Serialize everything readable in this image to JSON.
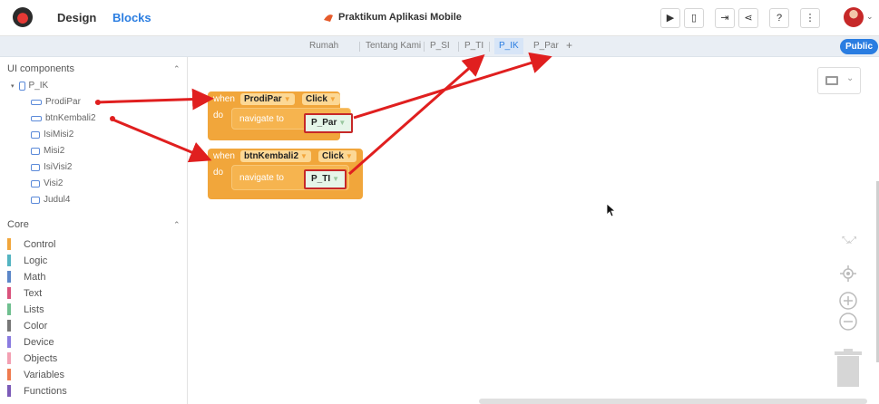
{
  "header": {
    "tabs": [
      "Design",
      "Blocks"
    ],
    "active_tab": "Blocks",
    "project_title": "Praktikum Aplikasi Mobile",
    "toolbar_icons": [
      "preview-icon",
      "phone-preview-icon",
      "export-icon",
      "share-icon",
      "help-icon",
      "more-icon"
    ]
  },
  "screens": {
    "tabs": [
      "Rumah",
      "Tentang Kami",
      "P_SI",
      "P_TI",
      "P_IK",
      "P_Par"
    ],
    "active": "P_IK",
    "add_label": "+",
    "visibility": "Public"
  },
  "sidebar": {
    "ui_heading": "UI components",
    "screen_node": "P_IK",
    "components": [
      {
        "label": "ProdiPar",
        "icon": "button-icon"
      },
      {
        "label": "btnKembali2",
        "icon": "button-icon"
      },
      {
        "label": "IsiMisi2",
        "icon": "label-icon"
      },
      {
        "label": "Misi2",
        "icon": "label-icon"
      },
      {
        "label": "IsiVisi2",
        "icon": "label-icon"
      },
      {
        "label": "Visi2",
        "icon": "label-icon"
      },
      {
        "label": "Judul4",
        "icon": "label-icon"
      }
    ],
    "core_heading": "Core",
    "categories": [
      {
        "label": "Control",
        "color": "#f1a63b"
      },
      {
        "label": "Logic",
        "color": "#53b4c1"
      },
      {
        "label": "Math",
        "color": "#5b86c8"
      },
      {
        "label": "Text",
        "color": "#d9527c"
      },
      {
        "label": "Lists",
        "color": "#6fbf8f"
      },
      {
        "label": "Color",
        "color": "#777777"
      },
      {
        "label": "Device",
        "color": "#8a7be0"
      },
      {
        "label": "Objects",
        "color": "#f3a0b3"
      },
      {
        "label": "Variables",
        "color": "#ef7b4f"
      },
      {
        "label": "Functions",
        "color": "#7c5bb8"
      }
    ]
  },
  "blocks": [
    {
      "when": "when",
      "component": "ProdiPar",
      "event": "Click",
      "do": "do",
      "action": "navigate to",
      "target": "P_Par"
    },
    {
      "when": "when",
      "component": "btnKembali2",
      "event": "Click",
      "do": "do",
      "action": "navigate to",
      "target": "P_TI"
    }
  ],
  "annotation_color": "#e01f1f"
}
